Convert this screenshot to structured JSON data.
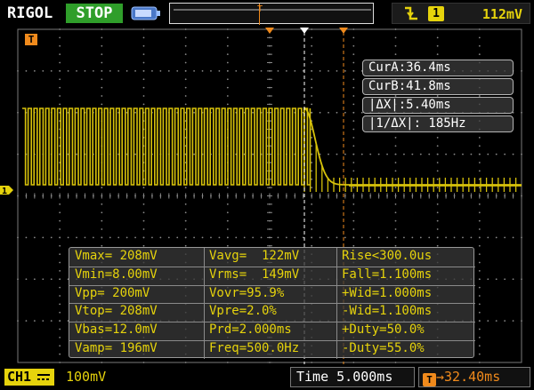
{
  "header": {
    "brand": "RIGOL",
    "run_state": "STOP",
    "trigger": {
      "slope_icon": "falling-edge-icon",
      "source": "1",
      "level": "112mV"
    },
    "colors": {
      "accent": "#e6d30c",
      "stop_green": "#2f9e2a",
      "trigger_orange": "#f08a1c",
      "usb_blue": "#4a78c8"
    }
  },
  "markers": {
    "trigger_marker": "T",
    "channel_marker": "1"
  },
  "cursors": {
    "cur_a": "CurA:36.4ms",
    "cur_b": "CurB:41.8ms",
    "delta_x": "|ΔX|:5.40ms",
    "inv_delta_x": "|1/ΔX|: 185Hz"
  },
  "measurements": {
    "rows": [
      [
        "Vmax= 208mV",
        "Vavg=  122mV",
        "Rise<300.0us"
      ],
      [
        "Vmin=8.00mV",
        "Vrms=  149mV",
        "Fall=1.100ms"
      ],
      [
        "Vpp= 200mV",
        "Vovr=95.9%",
        "+Wid=1.000ms"
      ],
      [
        "Vtop= 208mV",
        "Vpre=2.0%",
        "-Wid=1.100ms"
      ],
      [
        "Vbas=12.0mV",
        "Prd=2.000ms",
        "+Duty=50.0%"
      ],
      [
        "Vamp= 196mV",
        "Freq=500.0Hz",
        "-Duty=55.0%"
      ]
    ]
  },
  "footer": {
    "channel": "CH1",
    "coupling_icon": "dc-coupling-icon",
    "channel_scale": "100mV",
    "timebase": "Time 5.000ms",
    "trigger_offset_icon": "T",
    "trigger_offset": "32.40ms"
  },
  "waveform": {
    "description": "square-wave",
    "pulse_period_ms": 2.0,
    "high_level_mv": 208,
    "low_level_mv": 12,
    "decay_start_ms": 36.4,
    "decay_end_ms": 41.8
  }
}
